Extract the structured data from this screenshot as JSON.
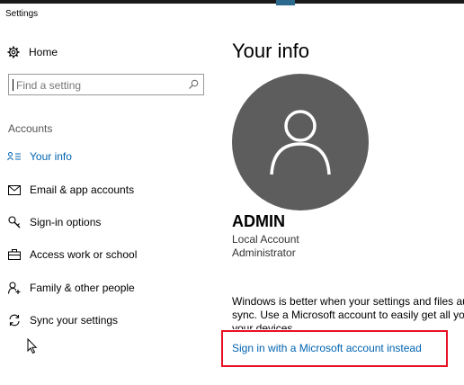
{
  "window": {
    "title": "Settings"
  },
  "sidebar": {
    "home_label": "Home",
    "search": {
      "placeholder": "Find a setting"
    },
    "section_label": "Accounts",
    "items": [
      {
        "label": "Your info",
        "icon": "contact-info-icon",
        "active": true
      },
      {
        "label": "Email & app accounts",
        "icon": "mail-icon",
        "active": false
      },
      {
        "label": "Sign-in options",
        "icon": "key-icon",
        "active": false
      },
      {
        "label": "Access work or school",
        "icon": "briefcase-icon",
        "active": false
      },
      {
        "label": "Family & other people",
        "icon": "add-person-icon",
        "active": false
      },
      {
        "label": "Sync your settings",
        "icon": "sync-icon",
        "active": false
      }
    ]
  },
  "main": {
    "title": "Your info",
    "user": {
      "name": "ADMIN",
      "account_type": "Local Account",
      "role": "Administrator"
    },
    "promo_lines": [
      "Windows is better when your settings and files aut",
      "sync. Use a Microsoft account to easily get all your",
      "your devices."
    ],
    "signin_link": "Sign in with a Microsoft account instead"
  },
  "colors": {
    "accent": "#0063b1",
    "avatar_bg": "#5d5d5d",
    "highlight": "#e81123"
  }
}
